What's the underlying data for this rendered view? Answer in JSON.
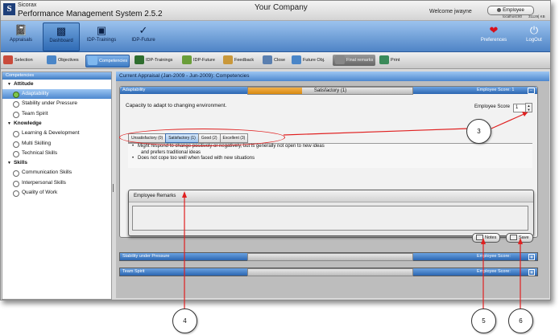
{
  "titlebar": {
    "brand": "Sicorax",
    "app_title": "Performance Management System 2.5.2",
    "company": "Your Company",
    "welcome": "Welcome jwayne",
    "role_button": "Employee",
    "host": "localhost:80",
    "memory": "31129[ KB"
  },
  "toolbar": {
    "appraisals": "Appraisals",
    "dashboard": "Dashboard",
    "idp_trainings": "IDP-Trainings",
    "idp_future": "IDP-Future",
    "preferences": "Preferences",
    "logout": "LogOut"
  },
  "steps": [
    "Selection",
    "Objectives",
    "Competencies",
    "IDP-Trainings",
    "IDP-Future",
    "Feedback",
    "Close",
    "Future Obj.",
    "Final remarks",
    "Print"
  ],
  "sidebar": {
    "header": "Competencies",
    "groups": [
      {
        "label": "Attitude",
        "items": [
          "Adaptability",
          "Stability under Pressure",
          "Team Spirit"
        ]
      },
      {
        "label": "Knowledge",
        "items": [
          "Learning & Development",
          "Multi Skilling",
          "Technical Skills"
        ]
      },
      {
        "label": "Skills",
        "items": [
          "Communication Skills",
          "Interpersonal Skills",
          "Quality of Work"
        ]
      }
    ]
  },
  "content": {
    "header": "Current Appraisal (Jan-2009 - Jun-2009): Competencies",
    "competency": {
      "name": "Adaptability",
      "rating": "Satisfactory (1)",
      "rating_fraction": 0.33,
      "score_label": "Employee Score: 1",
      "description": "Capacity to adapt to changing environment.",
      "employee_score_label": "Employee Score",
      "employee_score_value": "1"
    },
    "tabs": [
      "Unsatisfactory (0)",
      "Satisfactory (1)",
      "Good (2)",
      "Excellent (3)"
    ],
    "indicators": {
      "line1": "Might respond to change positively or negatively, but is generally not open to new ideas",
      "line1_cont": "and prefers traditional ideas",
      "line2": "Does not cope too well when faced with new situations"
    },
    "remarks_title": "Employee Remarks",
    "notes_button": "Notes",
    "save_button": "Save",
    "other_competencies": [
      {
        "name": "Stability under Pressure",
        "score_label": "Employee Score:"
      },
      {
        "name": "Team Spirit",
        "score_label": "Employee Score:"
      }
    ]
  },
  "callouts": [
    "3",
    "4",
    "5",
    "6"
  ],
  "colors": {
    "accent": "#4d88cf",
    "highlight": "#e02020",
    "rating_fill": "#e89a20"
  }
}
